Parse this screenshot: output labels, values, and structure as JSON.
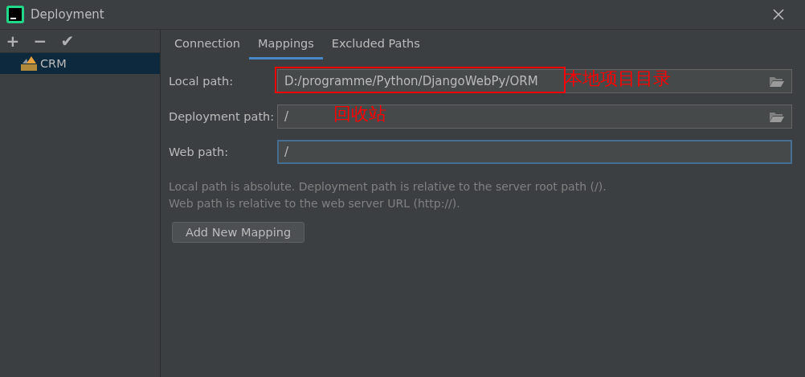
{
  "window": {
    "title": "Deployment"
  },
  "toolbar": [
    "+",
    "−",
    "✔"
  ],
  "servers": [
    {
      "name": "CRM",
      "selected": true
    }
  ],
  "tabs": [
    {
      "label": "Connection",
      "selected": false
    },
    {
      "label": "Mappings",
      "selected": true
    },
    {
      "label": "Excluded Paths",
      "selected": false
    }
  ],
  "fields": [
    {
      "label": "Local path:",
      "value": "D:/programme/Python/DjangoWebPy/ORM",
      "focused": false,
      "browse": true,
      "annotation": {
        "text": "本地项目目录",
        "boxed": true
      }
    },
    {
      "label": "Deployment path:",
      "value": "/",
      "focused": false,
      "browse": true,
      "annotation": {
        "text": "回收站",
        "boxed": false
      }
    },
    {
      "label": "Web path:",
      "value": "/",
      "focused": true,
      "browse": false
    }
  ],
  "hint": [
    "Local path is absolute. Deployment path is relative to the server root path (/).",
    "Web path is relative to the web server URL (http://)."
  ],
  "buttons": [
    "Add New Mapping"
  ]
}
